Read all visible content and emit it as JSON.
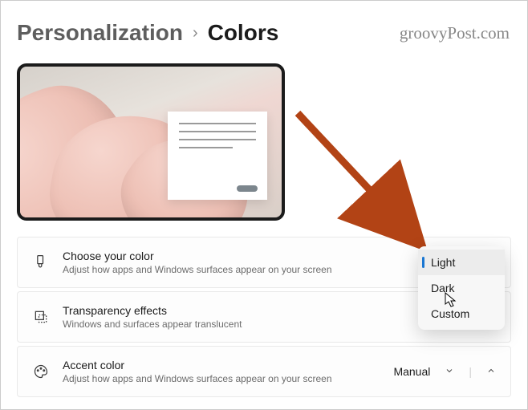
{
  "watermark": "groovyPost.com",
  "breadcrumb": {
    "parent": "Personalization",
    "current": "Colors"
  },
  "settings": {
    "choose_color": {
      "title": "Choose your color",
      "desc": "Adjust how apps and Windows surfaces appear on your screen"
    },
    "transparency": {
      "title": "Transparency effects",
      "desc": "Windows and surfaces appear translucent"
    },
    "accent": {
      "title": "Accent color",
      "desc": "Adjust how apps and Windows surfaces appear on your screen",
      "value": "Manual"
    }
  },
  "dropdown": {
    "options": [
      "Light",
      "Dark",
      "Custom"
    ],
    "selected": "Light"
  },
  "annotation_color": "#b24315"
}
